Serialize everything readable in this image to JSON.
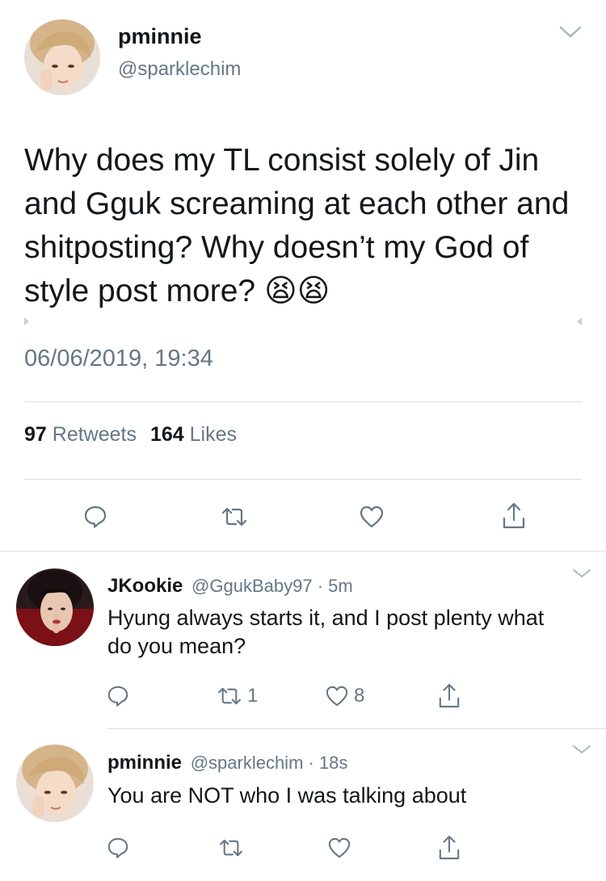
{
  "main_tweet": {
    "display_name": "pminnie",
    "handle": "@sparklechim",
    "text": "Why does my TL consist solely of Jin and Gguk screaming at each other and shitposting? Why doesn’t my God of style post more? 😫😫",
    "timestamp": "06/06/2019, 19:34",
    "retweet_count": "97",
    "retweet_label": "Retweets",
    "like_count": "164",
    "like_label": "Likes"
  },
  "replies": [
    {
      "display_name": "JKookie",
      "meta": "@GgukBaby97 · 5m",
      "text": "Hyung always starts it, and I post plenty what do you mean?",
      "retweet_count": "1",
      "like_count": "8"
    },
    {
      "display_name": "pminnie",
      "meta": "@sparklechim · 18s",
      "text": "You are NOT who I was talking about",
      "retweet_count": "",
      "like_count": ""
    }
  ],
  "icons": {
    "reply": "speech-bubble",
    "retweet": "retweet-arrows",
    "like": "heart-outline",
    "share": "share-upload",
    "menu": "chevron-down"
  },
  "colors": {
    "text": "#14171a",
    "secondary": "#657786",
    "divider": "#d7dde2"
  }
}
